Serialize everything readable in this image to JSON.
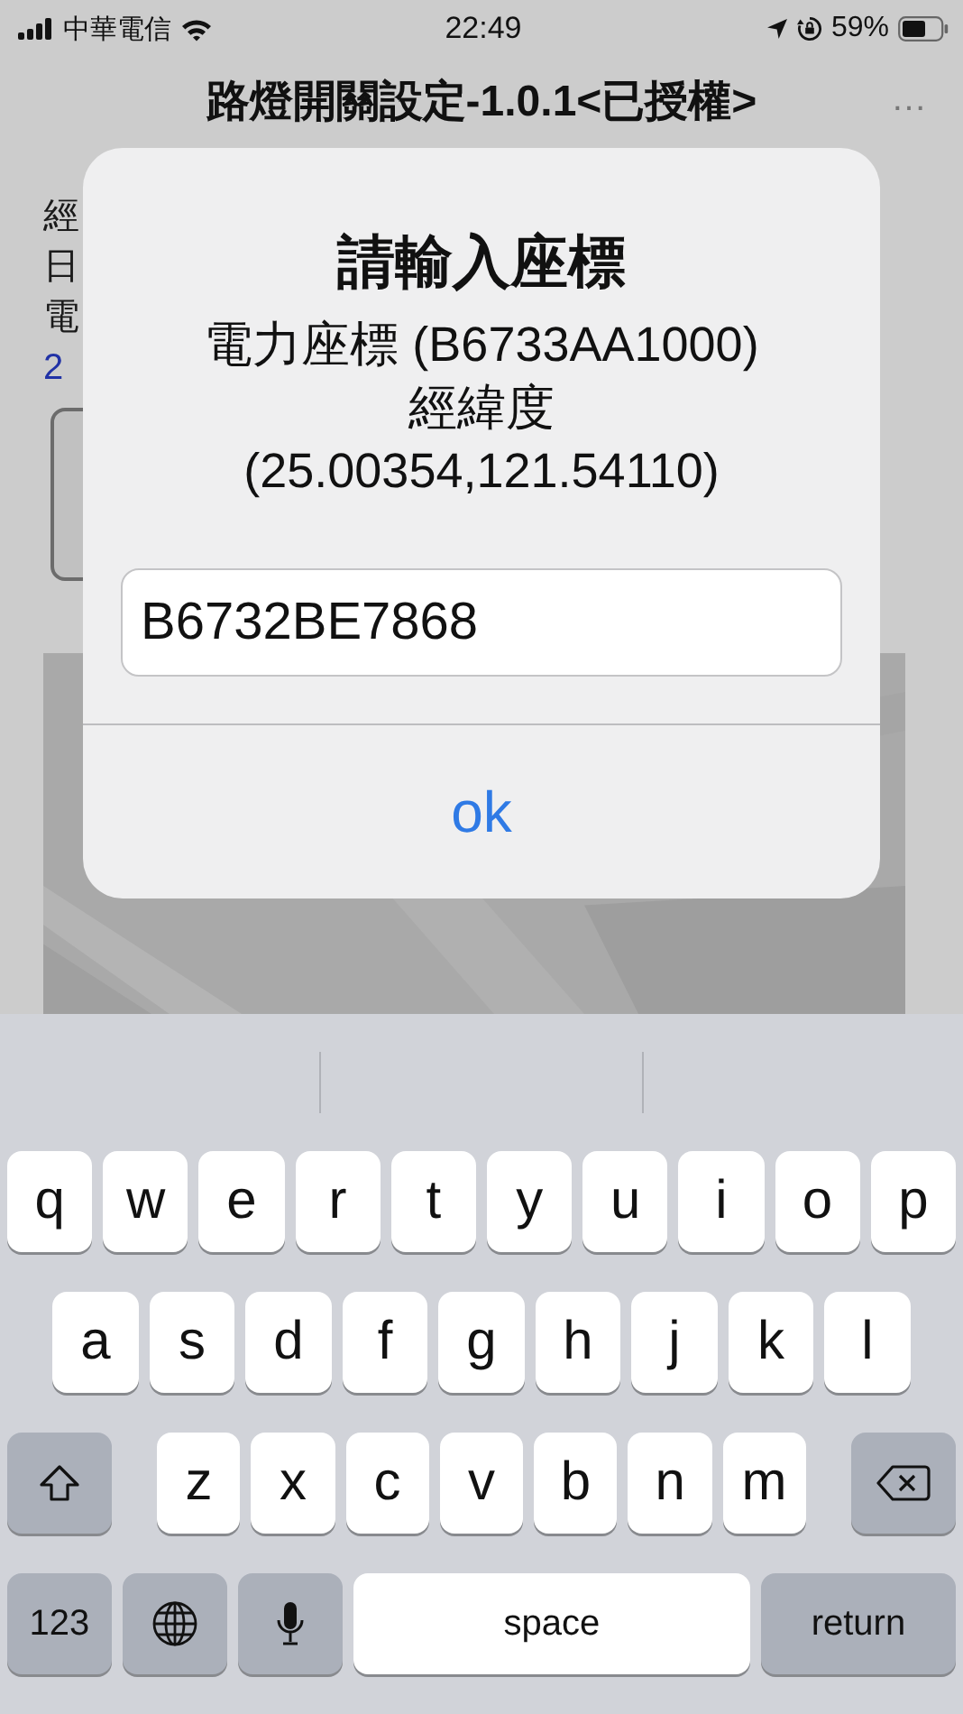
{
  "status_bar": {
    "carrier": "中華電信",
    "time": "22:49",
    "battery_percent": "59%"
  },
  "nav_bar": {
    "title": "路燈開關設定-1.0.1<已授權>",
    "menu": "…"
  },
  "background_text": [
    {
      "text": "經",
      "kind": "label"
    },
    {
      "text": "日",
      "kind": "value"
    },
    {
      "text": "電",
      "kind": "label"
    },
    {
      "text": "2",
      "kind": "link"
    }
  ],
  "dialog": {
    "title": "請輸入座標",
    "message_lines": [
      "電力座標 (B6733AA1000)",
      "經緯度",
      "(25.00354,121.54110)"
    ],
    "input": {
      "value": "B6732BE7868"
    },
    "button": "ok"
  },
  "keyboard": {
    "rows": [
      [
        "q",
        "w",
        "e",
        "r",
        "t",
        "y",
        "u",
        "i",
        "o",
        "p"
      ],
      [
        "a",
        "s",
        "d",
        "f",
        "g",
        "h",
        "j",
        "k",
        "l"
      ],
      [
        "z",
        "x",
        "c",
        "v",
        "b",
        "n",
        "m"
      ]
    ],
    "numbers_key": "123",
    "space_key": "space",
    "return_key": "return"
  }
}
